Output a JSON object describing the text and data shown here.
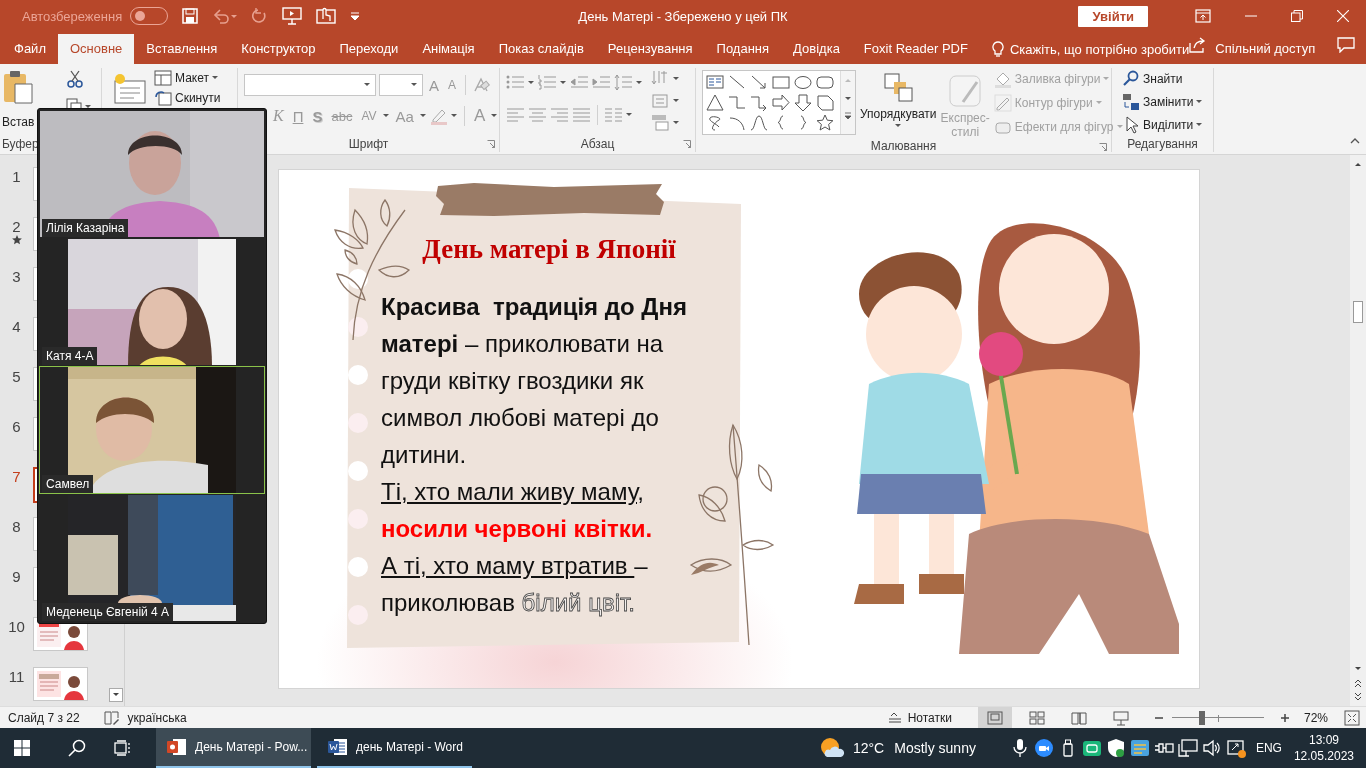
{
  "title_bar": {
    "autosave_label": "Автозбереження",
    "autosave_on": false,
    "title": "День Матері  -  Збережено у цей ПК",
    "sign_in": "Увійти"
  },
  "tabs": [
    {
      "label": "Файл",
      "selected": false
    },
    {
      "label": "Основне",
      "selected": true
    },
    {
      "label": "Вставлення",
      "selected": false
    },
    {
      "label": "Конструктор",
      "selected": false
    },
    {
      "label": "Переходи",
      "selected": false
    },
    {
      "label": "Анімація",
      "selected": false
    },
    {
      "label": "Показ слайдів",
      "selected": false
    },
    {
      "label": "Рецензування",
      "selected": false
    },
    {
      "label": "Подання",
      "selected": false
    },
    {
      "label": "Довідка",
      "selected": false
    },
    {
      "label": "Foxit Reader PDF",
      "selected": false
    }
  ],
  "tell_me": "Скажіть, що потрібно зробити",
  "share": "Спільний доступ",
  "ribbon": {
    "clipboard": {
      "paste": "Встав",
      "group": "Буфер"
    },
    "slides": {
      "layout": "Макет",
      "reset": "Скинути"
    },
    "font": {
      "group": "Шрифт",
      "size_buttons": [
        {
          "label": "A",
          "kind": "grow"
        },
        {
          "label": "A",
          "kind": "shrink"
        }
      ],
      "buttons": [
        {
          "label": "К",
          "kind": "italic"
        },
        {
          "label": "П",
          "kind": "underline"
        },
        {
          "label": "S",
          "kind": "shadow"
        },
        {
          "label": "abc",
          "kind": "strike"
        },
        {
          "label": "AV",
          "kind": "spacing"
        },
        {
          "label": "Aa",
          "kind": "case"
        },
        {
          "label": "A",
          "kind": "color"
        }
      ]
    },
    "paragraph": {
      "group": "Абзац"
    },
    "drawing": {
      "group": "Малювання",
      "arrange": "Упорядкувати",
      "quick_styles": [
        "Експрес-",
        "стилі"
      ],
      "commands": [
        {
          "label": "Заливка фігури",
          "kind": "fill",
          "disabled": true
        },
        {
          "label": "Контур фігури",
          "kind": "outline",
          "disabled": true
        },
        {
          "label": "Ефекти для фігур",
          "kind": "effects",
          "disabled": true
        }
      ]
    },
    "editing": {
      "group": "Редагування",
      "commands": [
        {
          "label": "Знайти",
          "kind": "find"
        },
        {
          "label": "Замінити",
          "kind": "replace"
        },
        {
          "label": "Виділити",
          "kind": "select"
        }
      ]
    }
  },
  "thumbnails": [
    {
      "number": "1",
      "selected": false,
      "animated": false
    },
    {
      "number": "2",
      "selected": false,
      "animated": true
    },
    {
      "number": "3",
      "selected": false,
      "animated": false
    },
    {
      "number": "4",
      "selected": false,
      "animated": false
    },
    {
      "number": "5",
      "selected": false,
      "animated": false
    },
    {
      "number": "6",
      "selected": false,
      "animated": false
    },
    {
      "number": "7",
      "selected": true,
      "animated": false
    },
    {
      "number": "8",
      "selected": false,
      "animated": false
    },
    {
      "number": "9",
      "selected": false,
      "animated": false
    },
    {
      "number": "10",
      "selected": false,
      "animated": false
    },
    {
      "number": "11",
      "selected": false,
      "animated": false
    }
  ],
  "slide": {
    "title": "День матері в Японії",
    "paragraphs": [
      {
        "segments": [
          {
            "text": "Красива  традиція до Дня матері",
            "kind": "bold"
          },
          {
            "text": " – приколювати на груди квітку гвоздики як символ любові матері до дитини.",
            "kind": "plain"
          }
        ]
      },
      {
        "segments": [
          {
            "text": "Ті, хто мали живу маму,",
            "kind": "underline"
          },
          {
            "text": " носили червоні квітки.",
            "kind": "red"
          }
        ]
      },
      {
        "segments": [
          {
            "text": "А ті, хто маму втратив ",
            "kind": "underline"
          },
          {
            "text": "– приколював ",
            "kind": "plain"
          },
          {
            "text": "білий цвіт.",
            "kind": "outline"
          }
        ]
      }
    ]
  },
  "video_tiles": [
    {
      "name": "Лілія Казаріна",
      "selected": false
    },
    {
      "name": "Катя  4-А",
      "selected": false
    },
    {
      "name": "Самвел",
      "selected": true
    },
    {
      "name": "Меденець Євгеній 4 А",
      "selected": false
    }
  ],
  "status_bar": {
    "slide_counter": "Слайд 7 з 22",
    "language": "українська",
    "notes": "Нотатки",
    "views": [
      {
        "kind": "normal",
        "selected": true
      },
      {
        "kind": "sorter",
        "selected": false
      },
      {
        "kind": "reading",
        "selected": false
      },
      {
        "kind": "slideshow",
        "selected": false
      }
    ],
    "zoom": {
      "level": 0.33,
      "reading": "72%"
    }
  },
  "taskbar": {
    "apps": [
      {
        "kind": "powerpoint",
        "label": "День Матері - Pow...",
        "selected": true
      },
      {
        "kind": "word",
        "label": "день Матері - Word",
        "selected": false
      }
    ],
    "weather": {
      "temperature": "12°C",
      "condition": "Mostly sunny"
    },
    "language": "ENG",
    "time": "13:09",
    "date": "12.05.2023"
  }
}
